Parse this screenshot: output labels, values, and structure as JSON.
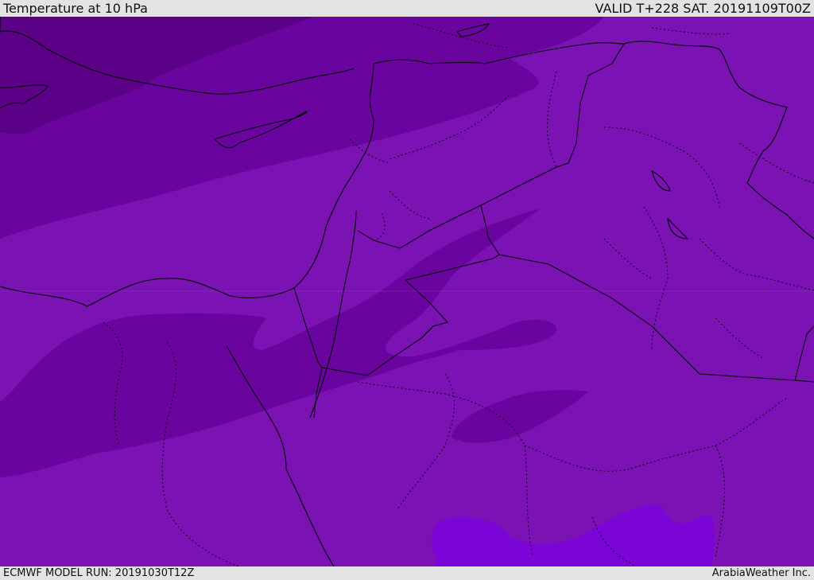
{
  "header": {
    "title": "Temperature at 10 hPa",
    "valid": "VALID T+228 SAT. 20191109T00Z"
  },
  "footer": {
    "model_run": "ECMWF MODEL RUN: 20191030T12Z",
    "credit": "ArabiaWeather Inc."
  },
  "colors": {
    "field_base": "#7a12b4",
    "field_dark": "#6a049e",
    "field_darker": "#5b0188",
    "field_light": "#7b04d6",
    "border": "#000000",
    "frame": "#e3e3e3"
  }
}
